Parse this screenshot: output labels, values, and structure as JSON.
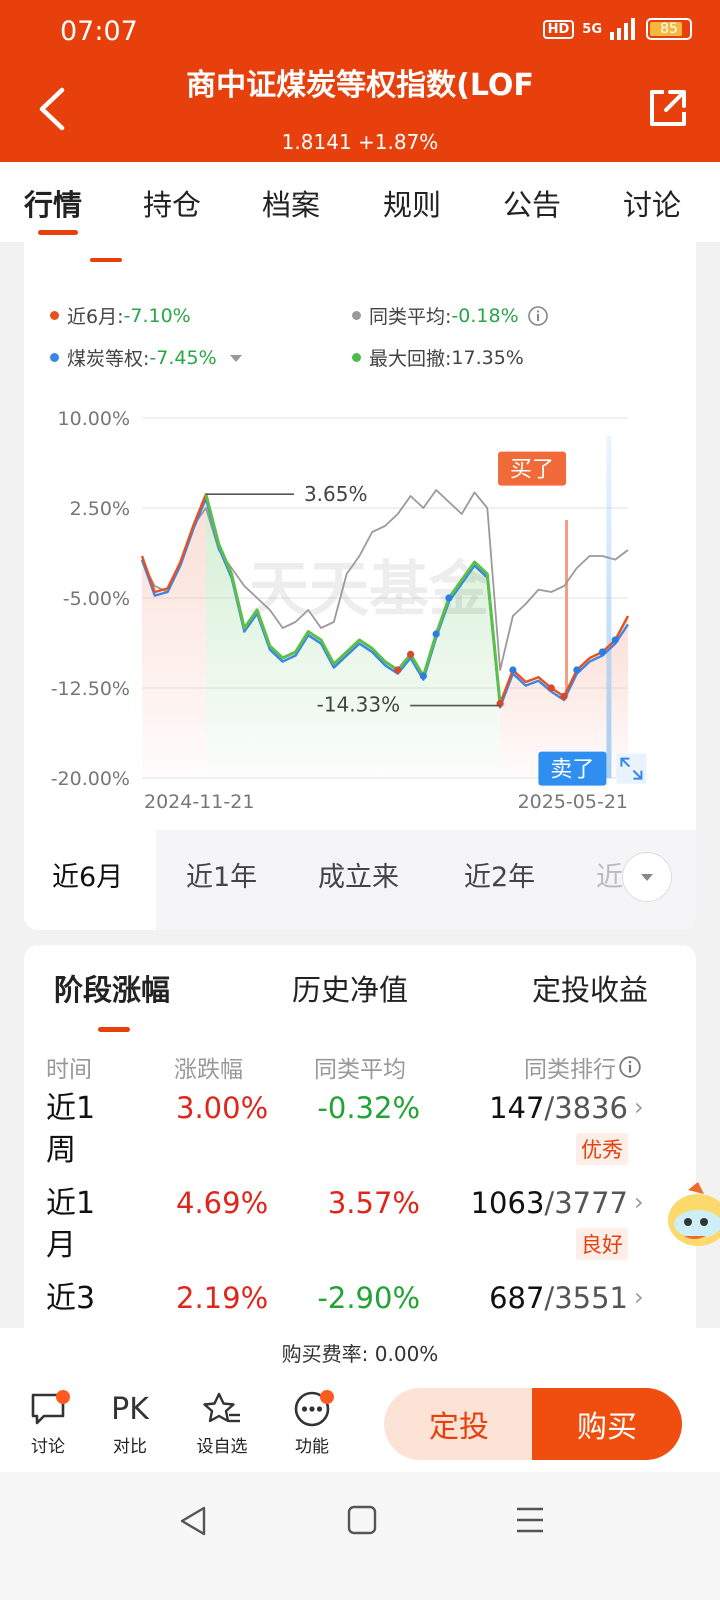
{
  "status": {
    "time": "07:07",
    "hd": "HD",
    "network": "5G",
    "battery": "85",
    "battery_level": 0.85
  },
  "header": {
    "title": "商中证煤炭等权指数(LOF",
    "subtitle": "1.8141 +1.87%"
  },
  "tabs": [
    "行情",
    "持仓",
    "档案",
    "规则",
    "公告",
    "讨论"
  ],
  "legend": {
    "item1_label": "近6月:",
    "item1_value": "-7.10%",
    "item2_label": "同类平均:",
    "item2_value": "-0.18%",
    "item3_label": "煤炭等权:",
    "item3_value": "-7.45%",
    "item4_label": "最大回撤:",
    "item4_value": "17.35%"
  },
  "chart_data": {
    "type": "line",
    "yticks": [
      "10.00%",
      "2.50%",
      "-5.00%",
      "-12.50%",
      "-20.00%"
    ],
    "ylim": [
      -20,
      10
    ],
    "x_start": "2024-11-21",
    "x_end": "2025-05-21",
    "watermark": "天天基金",
    "annotations": {
      "high": "3.65%",
      "low": "-14.33%",
      "buy": "买了",
      "sell": "卖了"
    },
    "series": [
      {
        "name": "近6月",
        "color": "#e8501e",
        "values": [
          -1.5,
          -4.5,
          -4.2,
          -2,
          1,
          3.65,
          -0.5,
          -3,
          -7.5,
          -6,
          -9,
          -10,
          -9.5,
          -7.8,
          -8.5,
          -10.5,
          -9.5,
          -8.5,
          -9.2,
          -10.3,
          -11,
          -9.7,
          -11.5,
          -8,
          -5,
          -3.5,
          -2,
          -3,
          -13.8,
          -11,
          -12,
          -11.6,
          -12.5,
          -13.2,
          -11,
          -10,
          -9.5,
          -8.5,
          -6.5
        ]
      },
      {
        "name": "同类平均",
        "color": "#9a9a9a",
        "values": [
          -2,
          -4,
          -4.5,
          -2,
          1,
          2.5,
          -1,
          -2.5,
          -4,
          -5,
          -6,
          -7.5,
          -7,
          -6,
          -7.5,
          -7,
          -3,
          -1.5,
          0.5,
          1,
          2,
          3.5,
          2.5,
          4,
          3,
          2,
          3.8,
          2.5,
          -11,
          -6.5,
          -5.5,
          -4.3,
          -4.5,
          -4,
          -2.5,
          -1.5,
          -1.5,
          -1.8,
          -1
        ]
      },
      {
        "name": "煤炭等权",
        "color": "#3a86e8",
        "values": [
          -1.8,
          -4.8,
          -4.5,
          -2.3,
          0.7,
          3.3,
          -0.8,
          -3.3,
          -7.8,
          -6.3,
          -9.3,
          -10.3,
          -9.8,
          -8.1,
          -8.8,
          -10.8,
          -9.8,
          -8.8,
          -9.5,
          -10.6,
          -11.3,
          -10,
          -11.8,
          -8.3,
          -5.3,
          -3.8,
          -2.3,
          -3.3,
          -14.1,
          -11.3,
          -12.3,
          -11.9,
          -12.8,
          -13.5,
          -11.3,
          -10.3,
          -9.8,
          -8.8,
          -7.2
        ]
      }
    ]
  },
  "ranges": [
    "近6月",
    "近1年",
    "成立来",
    "近2年",
    "近"
  ],
  "returns": {
    "tabs": [
      "阶段涨幅",
      "历史净值",
      "定投收益"
    ],
    "columns": [
      "时间",
      "涨跌幅",
      "同类平均",
      "同类排行"
    ],
    "rows": [
      {
        "period": "近1周",
        "change": "3.00%",
        "avg": "-0.32%",
        "rank": "147",
        "total": "/3836",
        "badge": "优秀"
      },
      {
        "period": "近1月",
        "change": "4.69%",
        "avg": "3.57%",
        "rank": "1063",
        "total": "/3777",
        "badge": "良好"
      },
      {
        "period": "近3",
        "change": "2.19%",
        "avg": "-2.90%",
        "rank": "687",
        "total": "/3551",
        "badge": ""
      }
    ]
  },
  "fee": "购买费率: 0.00%",
  "bottom": {
    "discuss": "讨论",
    "pk": "PK",
    "compare": "对比",
    "watch": "设自选",
    "func": "功能",
    "dingtou": "定投",
    "buy": "购买"
  }
}
